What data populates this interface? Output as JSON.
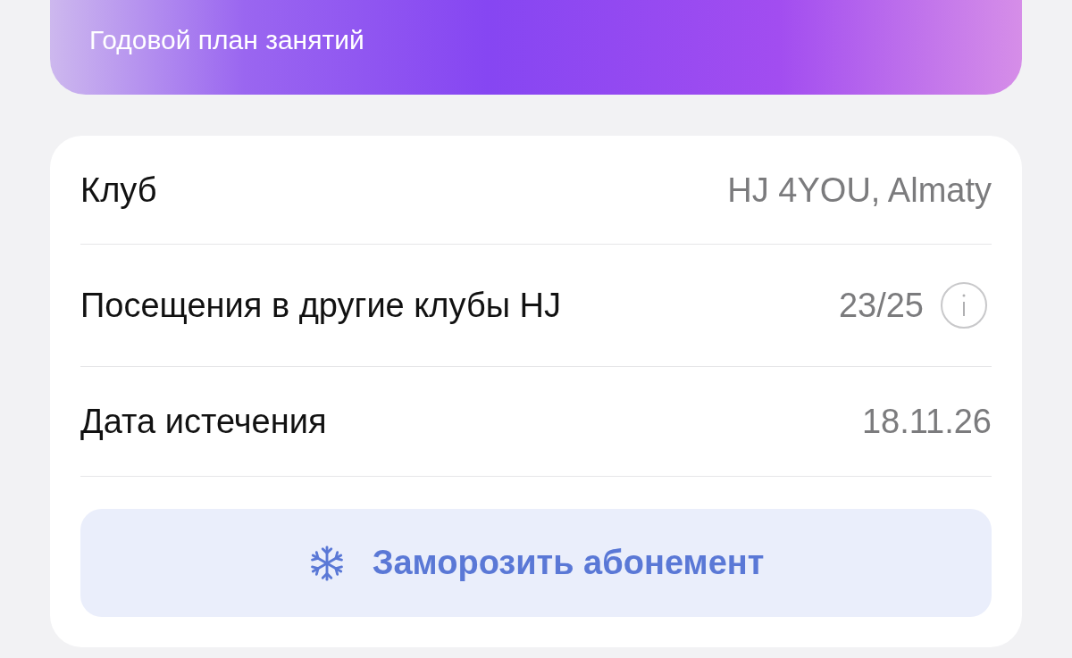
{
  "banner": {
    "subtitle": "Годовой план занятий"
  },
  "details": [
    {
      "label": "Клуб",
      "value": "HJ 4YOU, Almaty",
      "info": false
    },
    {
      "label": "Посещения в другие клубы HJ",
      "value": "23/25",
      "info": true
    },
    {
      "label": "Дата истечения",
      "value": "18.11.26",
      "info": false
    }
  ],
  "freeze_button": {
    "label": "Заморозить абонемент"
  }
}
